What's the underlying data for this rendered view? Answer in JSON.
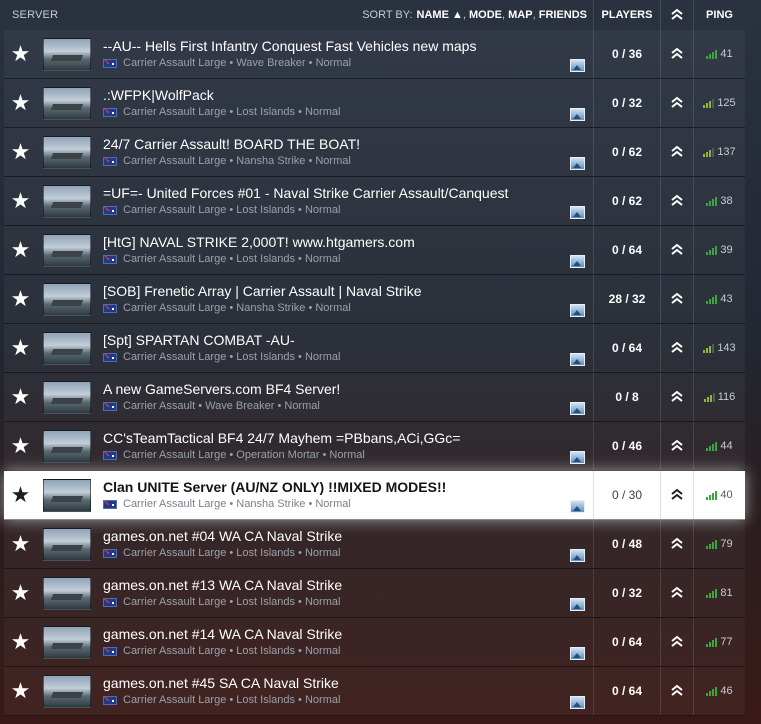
{
  "header": {
    "server": "SERVER",
    "sort_by_label": "SORT BY:",
    "sort_name": "NAME ▲",
    "sort_mode": "MODE",
    "sort_map": "MAP",
    "sort_friends": "FRIENDS",
    "players": "PLAYERS",
    "rank_icon": "rank-chevron-icon",
    "ping": "PING"
  },
  "colors": {
    "ping_good": "#3aa640",
    "selected_row": "#ffffff"
  },
  "servers": [
    {
      "name": "--AU-- Hells First Infantry Conquest Fast Vehicles new maps",
      "mode": "Carrier Assault Large",
      "map": "Wave Breaker",
      "preset": "Normal",
      "players": "0 / 36",
      "ping": "41",
      "selected": false
    },
    {
      "name": ".:WFPK|WolfPack",
      "mode": "Carrier Assault Large",
      "map": "Lost Islands",
      "preset": "Normal",
      "players": "0 / 32",
      "ping": "125",
      "selected": false
    },
    {
      "name": "24/7 Carrier Assault! BOARD THE BOAT!",
      "mode": "Carrier Assault Large",
      "map": "Nansha Strike",
      "preset": "Normal",
      "players": "0 / 62",
      "ping": "137",
      "selected": false
    },
    {
      "name": "=UF=- United Forces #01 - Naval Strike Carrier Assault/Canquest",
      "mode": "Carrier Assault Large",
      "map": "Lost Islands",
      "preset": "Normal",
      "players": "0 / 62",
      "ping": "38",
      "selected": false
    },
    {
      "name": "[HtG] NAVAL STRIKE 2,000T! www.htgamers.com",
      "mode": "Carrier Assault Large",
      "map": "Lost Islands",
      "preset": "Normal",
      "players": "0 / 64",
      "ping": "39",
      "selected": false
    },
    {
      "name": "[SOB] Frenetic Array | Carrier Assault | Naval Strike",
      "mode": "Carrier Assault Large",
      "map": "Nansha Strike",
      "preset": "Normal",
      "players": "28 / 32",
      "ping": "43",
      "selected": false
    },
    {
      "name": "[Spt] SPARTAN COMBAT -AU-",
      "mode": "Carrier Assault Large",
      "map": "Lost Islands",
      "preset": "Normal",
      "players": "0 / 64",
      "ping": "143",
      "selected": false
    },
    {
      "name": "A new GameServers.com BF4 Server!",
      "mode": "Carrier Assault",
      "map": "Wave Breaker",
      "preset": "Normal",
      "players": "0 / 8",
      "ping": "116",
      "selected": false
    },
    {
      "name": "CC'sTeamTactical BF4 24/7 Mayhem =PBbans,ACi,GGc=",
      "mode": "Carrier Assault Large",
      "map": "Operation Mortar",
      "preset": "Normal",
      "players": "0 / 46",
      "ping": "44",
      "selected": false
    },
    {
      "name": "Clan UNITE Server (AU/NZ ONLY) !!MIXED MODES!!",
      "mode": "Carrier Assault Large",
      "map": "Nansha Strike",
      "preset": "Normal",
      "players": "0 / 30",
      "ping": "40",
      "selected": true
    },
    {
      "name": "games.on.net #04 WA CA Naval Strike",
      "mode": "Carrier Assault Large",
      "map": "Lost Islands",
      "preset": "Normal",
      "players": "0 / 48",
      "ping": "79",
      "selected": false
    },
    {
      "name": "games.on.net #13 WA CA Naval Strike",
      "mode": "Carrier Assault Large",
      "map": "Lost Islands",
      "preset": "Normal",
      "players": "0 / 32",
      "ping": "81",
      "selected": false
    },
    {
      "name": "games.on.net #14 WA CA Naval Strike",
      "mode": "Carrier Assault Large",
      "map": "Lost Islands",
      "preset": "Normal",
      "players": "0 / 64",
      "ping": "77",
      "selected": false
    },
    {
      "name": "games.on.net #45 SA CA Naval Strike",
      "mode": "Carrier Assault Large",
      "map": "Lost Islands",
      "preset": "Normal",
      "players": "0 / 64",
      "ping": "46",
      "selected": false
    }
  ]
}
